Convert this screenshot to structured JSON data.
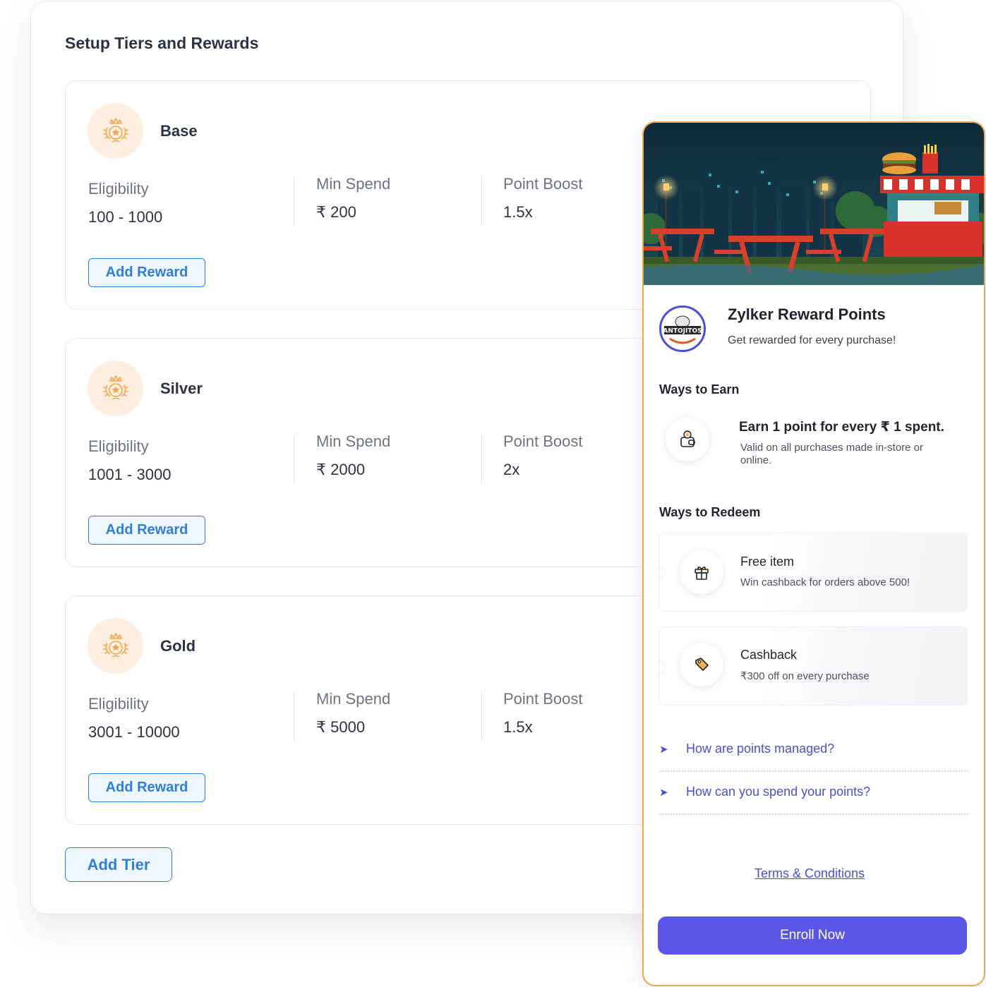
{
  "setup": {
    "title": "Setup Tiers and Rewards",
    "add_tier_label": "Add Tier",
    "tiers": [
      {
        "name": "Base",
        "eligibility_label": "Eligibility",
        "eligibility": "100 - 1000",
        "min_spend_label": "Min Spend",
        "min_spend": "₹ 200",
        "point_boost_label": "Point Boost",
        "point_boost": "1.5x",
        "add_reward_label": "Add Reward"
      },
      {
        "name": "Silver",
        "eligibility_label": "Eligibility",
        "eligibility": "1001 - 3000",
        "min_spend_label": "Min Spend",
        "min_spend": "₹ 2000",
        "point_boost_label": "Point Boost",
        "point_boost": "2x",
        "add_reward_label": "Add Reward"
      },
      {
        "name": "Gold",
        "eligibility_label": "Eligibility",
        "eligibility": "3001 - 10000",
        "min_spend_label": "Min Spend",
        "min_spend": "₹ 5000",
        "point_boost_label": "Point Boost",
        "point_boost": "1.5x",
        "add_reward_label": "Add Reward"
      }
    ]
  },
  "preview": {
    "brand_logo_text": "ANTOJITOS",
    "program_title": "Zylker Reward Points",
    "program_subtitle": "Get rewarded for every purchase!",
    "ways_to_earn_heading": "Ways to Earn",
    "earn": {
      "title": "Earn 1 point for every ₹ 1 spent.",
      "description": "Valid on all purchases made in-store or online."
    },
    "ways_to_redeem_heading": "Ways to Redeem",
    "redeem": [
      {
        "title": "Free item",
        "description": "Win cashback for orders above 500!",
        "icon": "gift-icon"
      },
      {
        "title": "Cashback",
        "description": "₹300 off on every purchase",
        "icon": "tag-icon"
      }
    ],
    "faqs": [
      "How are points managed?",
      "How can you spend your points?"
    ],
    "terms_label": "Terms & Conditions",
    "enroll_label": "Enroll Now",
    "colors": {
      "accent": "#5b57e6",
      "panel_border": "#f0a64a",
      "link_blue": "#2f7fd9"
    }
  }
}
